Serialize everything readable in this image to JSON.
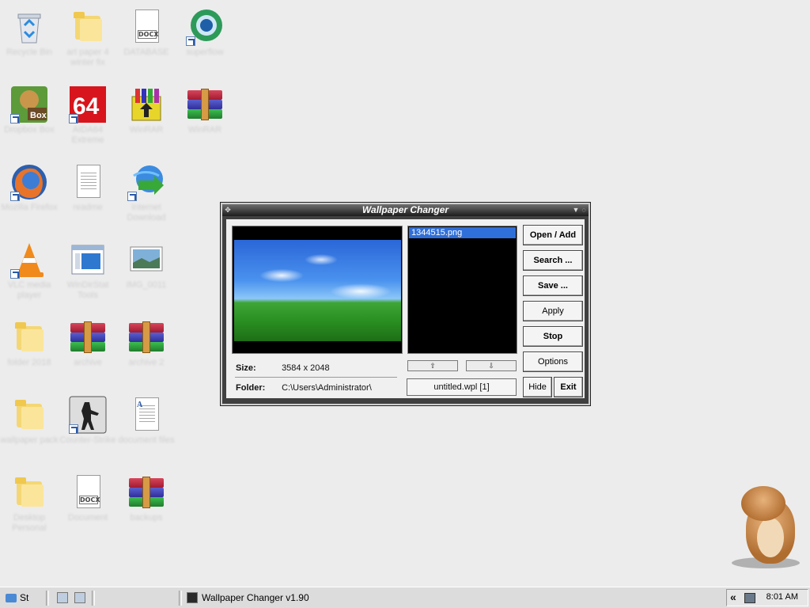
{
  "desktop_icons": [
    {
      "label": "Recycle Bin"
    },
    {
      "label": "art paper 4 winter fix"
    },
    {
      "label": "DATABASE"
    },
    {
      "label": "superflow"
    },
    {
      "label": "Dropbox Box"
    },
    {
      "label": "AIDA64 Extreme"
    },
    {
      "label": "WinRAR"
    },
    {
      "label": "WinRAR"
    },
    {
      "label": "Mozilla Firefox"
    },
    {
      "label": "readme"
    },
    {
      "label": "Internet Download"
    },
    {
      "label": "VLC media player"
    },
    {
      "label": "WinDirStat Tools"
    },
    {
      "label": "IMG_0011"
    },
    {
      "label": "folder 2018"
    },
    {
      "label": "archive"
    },
    {
      "label": "archive 2"
    },
    {
      "label": "wallpaper pack"
    },
    {
      "label": "Counter-Strike"
    },
    {
      "label": "document files"
    },
    {
      "label": "Desktop Personal"
    },
    {
      "label": "Document"
    },
    {
      "label": "backups"
    }
  ],
  "window": {
    "title": "Wallpaper Changer",
    "info": {
      "size_label": "Size:",
      "size_value": "3584 x 2048",
      "folder_label": "Folder:",
      "folder_value": "C:\\Users\\Administrator\\"
    },
    "playlist": {
      "items": [
        "1344515.png"
      ],
      "up_arrow": "⇧",
      "down_arrow": "⇩",
      "file": "untitled.wpl  [1]"
    },
    "buttons": {
      "open_add": "Open / Add",
      "search": "Search ...",
      "save": "Save ...",
      "apply": "Apply",
      "stop": "Stop",
      "options": "Options",
      "hide": "Hide",
      "exit": "Exit"
    }
  },
  "taskbar": {
    "start_label": "St",
    "task_label": "Wallpaper Changer v1.90",
    "tray_chevron": "«",
    "clock": "8:01 AM"
  }
}
